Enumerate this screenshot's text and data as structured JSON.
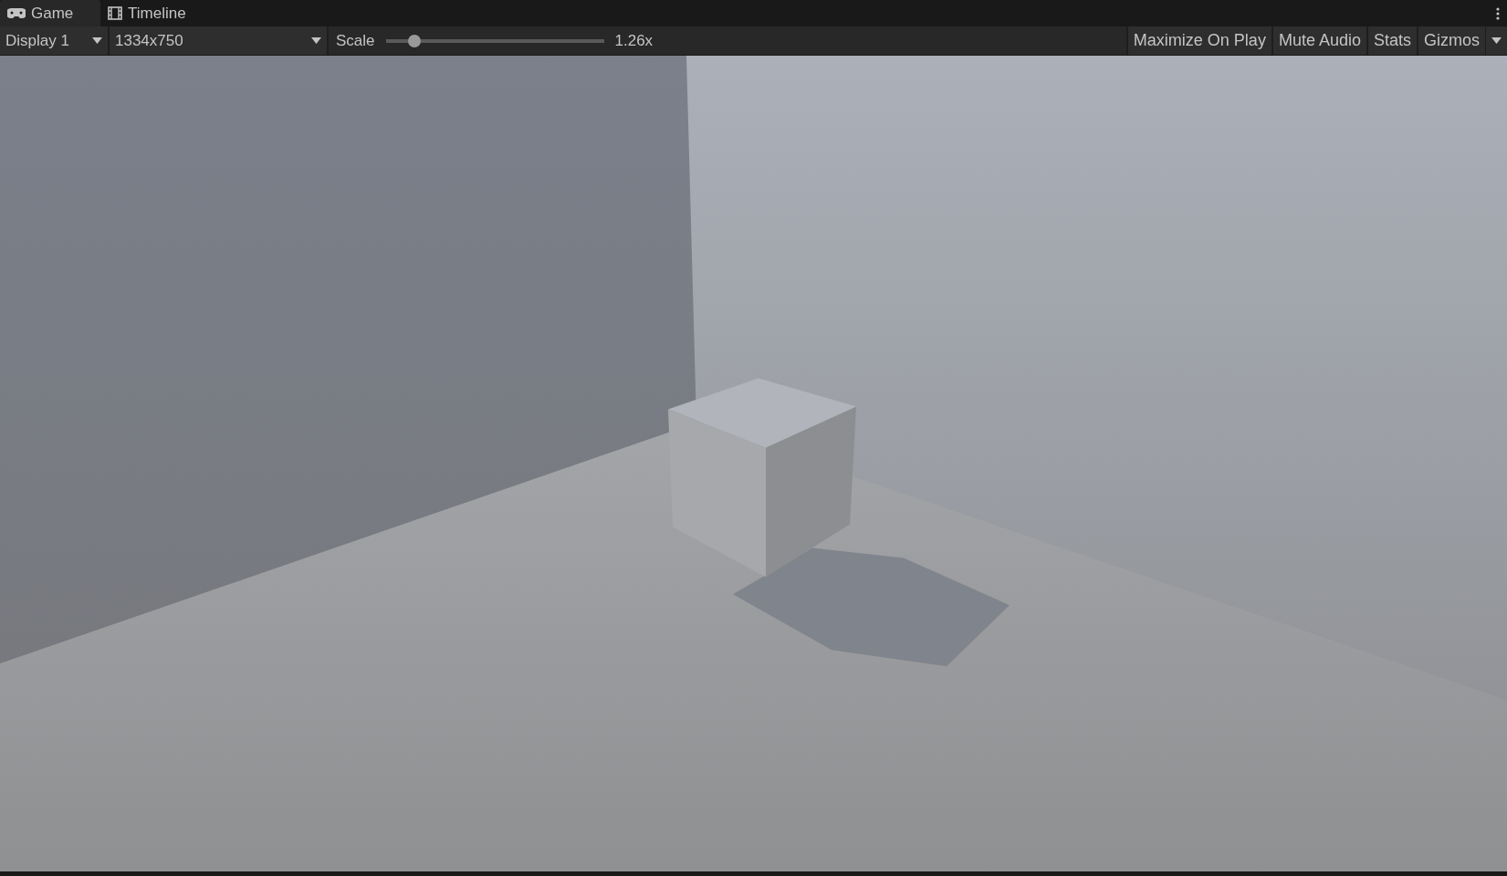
{
  "tabs": [
    {
      "label": "Game",
      "kind": "game",
      "selected": true
    },
    {
      "label": "Timeline",
      "kind": "timeline",
      "selected": false
    }
  ],
  "toolbar": {
    "display": "Display 1",
    "resolution": "1334x750",
    "scale": {
      "label": "Scale",
      "level": 0.13,
      "reading": "1.26x"
    },
    "toggles": [
      "Maximize On Play",
      "Mute Audio",
      "Stats",
      "Gizmos"
    ]
  }
}
